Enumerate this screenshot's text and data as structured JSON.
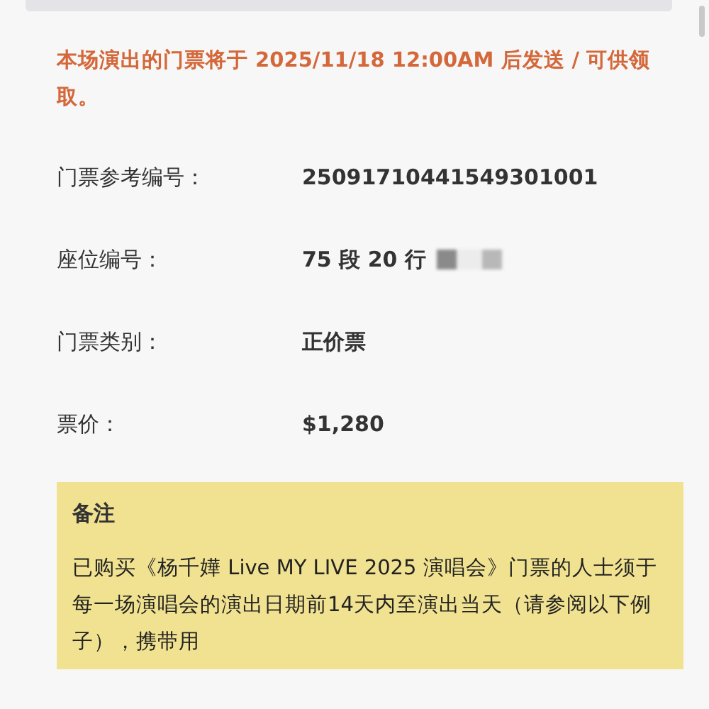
{
  "notice": "本场演出的门票将于 2025/11/18 12:00AM 后发送 / 可供领取。",
  "fields": [
    {
      "label": "门票参考编号：",
      "value": "25091710441549301001",
      "redacted": false
    },
    {
      "label": "座位编号：",
      "value": "75 段 20 行",
      "redacted": true
    },
    {
      "label": "门票类别：",
      "value": "正价票",
      "redacted": false
    },
    {
      "label": "票价：",
      "value": "$1,280",
      "redacted": false
    }
  ],
  "remarks": {
    "title": "备注",
    "text": "已购买《杨千嬅 Live MY LIVE 2025 演唱会》门票的人士须于每一场演唱会的演出日期前14天内至演出当天（请参阅以下例子），携带用"
  }
}
